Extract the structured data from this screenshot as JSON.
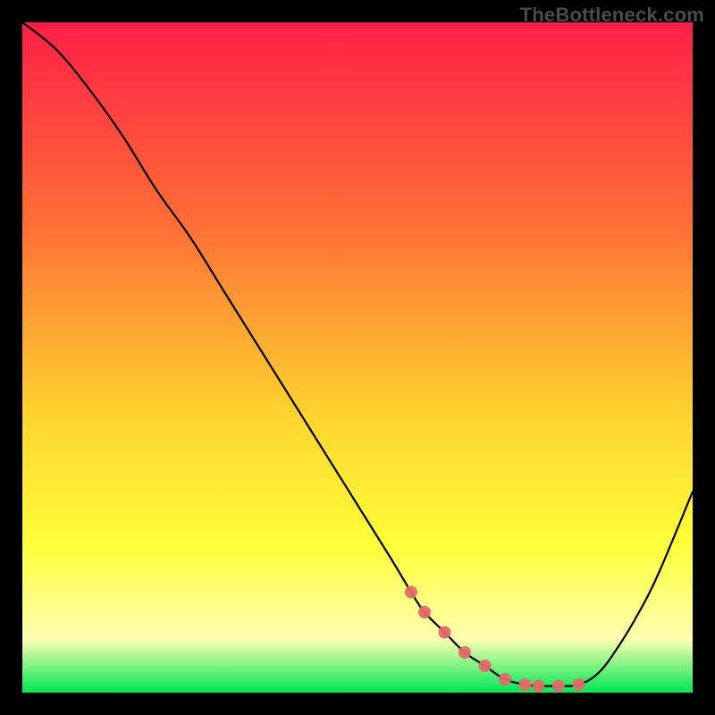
{
  "watermark": "TheBottleneck.com",
  "colors": {
    "gradient_top": "#ff1f47",
    "gradient_mid_upper": "#ff6e36",
    "gradient_mid": "#ffd22e",
    "gradient_mid_lower": "#ffff3a",
    "gradient_low": "#feffb0",
    "gradient_bottom": "#00e756",
    "curve": "#000000",
    "marker": "#e26a6a",
    "axis_stroke": "#000000"
  },
  "chart_data": {
    "type": "line",
    "title": "",
    "xlabel": "",
    "ylabel": "",
    "xlim": [
      0,
      100
    ],
    "ylim": [
      0,
      100
    ],
    "x": [
      0,
      5,
      10,
      15,
      20,
      25,
      30,
      35,
      40,
      45,
      50,
      55,
      58,
      60,
      63,
      66,
      69,
      72,
      75,
      77,
      80,
      83,
      86,
      89,
      92,
      95,
      100
    ],
    "values": [
      100,
      96,
      90,
      83,
      75,
      68,
      60,
      52,
      44,
      36,
      28,
      20,
      15,
      12,
      9,
      6,
      4,
      2,
      1.2,
      1,
      1,
      1.2,
      3,
      7,
      12,
      18,
      30
    ],
    "markers_x": [
      58,
      60,
      63,
      66,
      69,
      72,
      75,
      77,
      80,
      83
    ],
    "markers_y": [
      15,
      12,
      9,
      6,
      4,
      2,
      1.2,
      1,
      1,
      1.2
    ],
    "marker_radius_px": 7
  }
}
